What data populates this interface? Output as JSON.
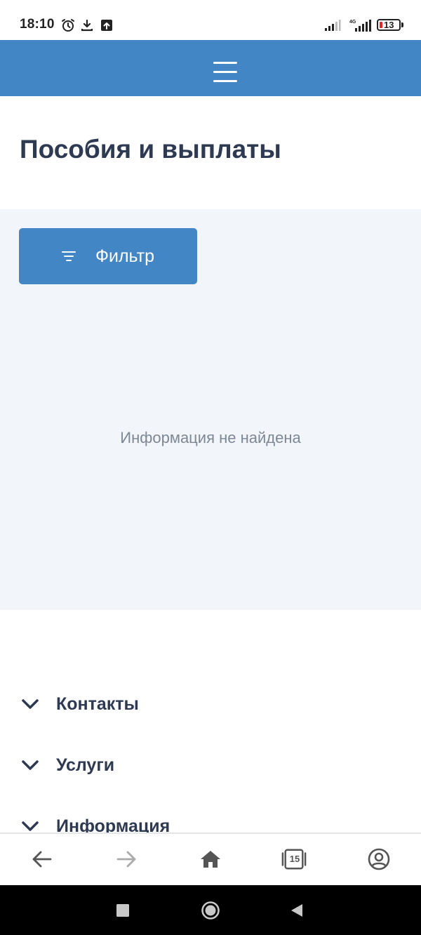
{
  "status_bar": {
    "time": "18:10",
    "icons": [
      "alarm-icon",
      "download-icon",
      "upload-icon",
      "signal-icon",
      "signal-4g-icon"
    ],
    "network_label": "4G",
    "battery_level": "13",
    "battery_color": "#e0262c"
  },
  "header": {
    "background": "#4286c6",
    "menu_icon": "hamburger-menu-icon"
  },
  "page": {
    "title": "Пособия и выплаты",
    "filter_label": "Фильтр",
    "filter_icon": "filter-icon",
    "empty_message": "Информация не найдена"
  },
  "footer": {
    "items": [
      {
        "label": "Контакты",
        "icon": "chevron-down-icon"
      },
      {
        "label": "Услуги",
        "icon": "chevron-down-icon"
      },
      {
        "label": "Информация",
        "icon": "chevron-down-icon"
      }
    ]
  },
  "browser_nav": {
    "tabs_count": "15",
    "icons": [
      "back-arrow-icon",
      "forward-arrow-icon",
      "home-icon",
      "tabs-icon",
      "profile-icon"
    ]
  },
  "system_nav": {
    "icons": [
      "recents-square-icon",
      "home-circle-icon",
      "back-triangle-icon"
    ]
  }
}
